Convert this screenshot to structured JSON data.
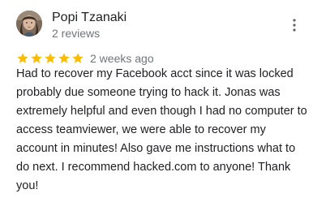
{
  "review": {
    "reviewer_name": "Popi Tzanaki",
    "review_count": "2 reviews",
    "rating": 5,
    "max_rating": 5,
    "date": "2 weeks ago",
    "text": "Had to recover my Facebook acct since it was locked probably due someone trying to hack it. Jonas was extremely helpful and even though I had no computer to access teamviewer, we were able to recover my account in minutes! Also gave me instructions what to do next. I recommend hacked.com to anyone! Thank you!"
  },
  "icons": {
    "star": "star-icon",
    "more": "more-vert-icon",
    "avatar": "avatar"
  },
  "colors": {
    "star": "#fbbc04",
    "name_text": "#202124",
    "secondary_text": "#70757a",
    "body_text": "#202124"
  }
}
